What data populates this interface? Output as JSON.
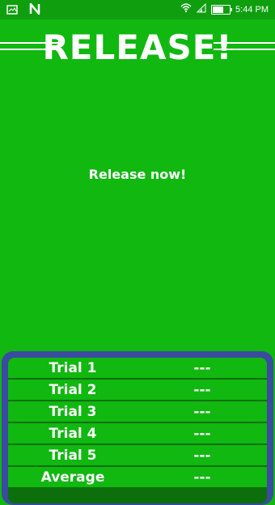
{
  "status_bar": {
    "left_icons": [
      "gallery-icon",
      "n-notification-icon"
    ],
    "right_icons": [
      "wifi-icon",
      "signal-icon",
      "battery-icon"
    ],
    "time": "5:44 PM"
  },
  "header": {
    "title": "RELEASE!"
  },
  "main": {
    "message": "Release now!"
  },
  "results": {
    "rows": [
      {
        "label": "Trial 1",
        "value": "---"
      },
      {
        "label": "Trial 2",
        "value": "---"
      },
      {
        "label": "Trial 3",
        "value": "---"
      },
      {
        "label": "Trial 4",
        "value": "---"
      },
      {
        "label": "Trial 5",
        "value": "---"
      },
      {
        "label": "Average",
        "value": "---"
      }
    ]
  },
  "colors": {
    "background": "#10b810",
    "status_bar": "#0e9e0e",
    "panel_border": "#3b4ba0",
    "row_divider": "#0c6f0c",
    "text": "#ffffff"
  }
}
